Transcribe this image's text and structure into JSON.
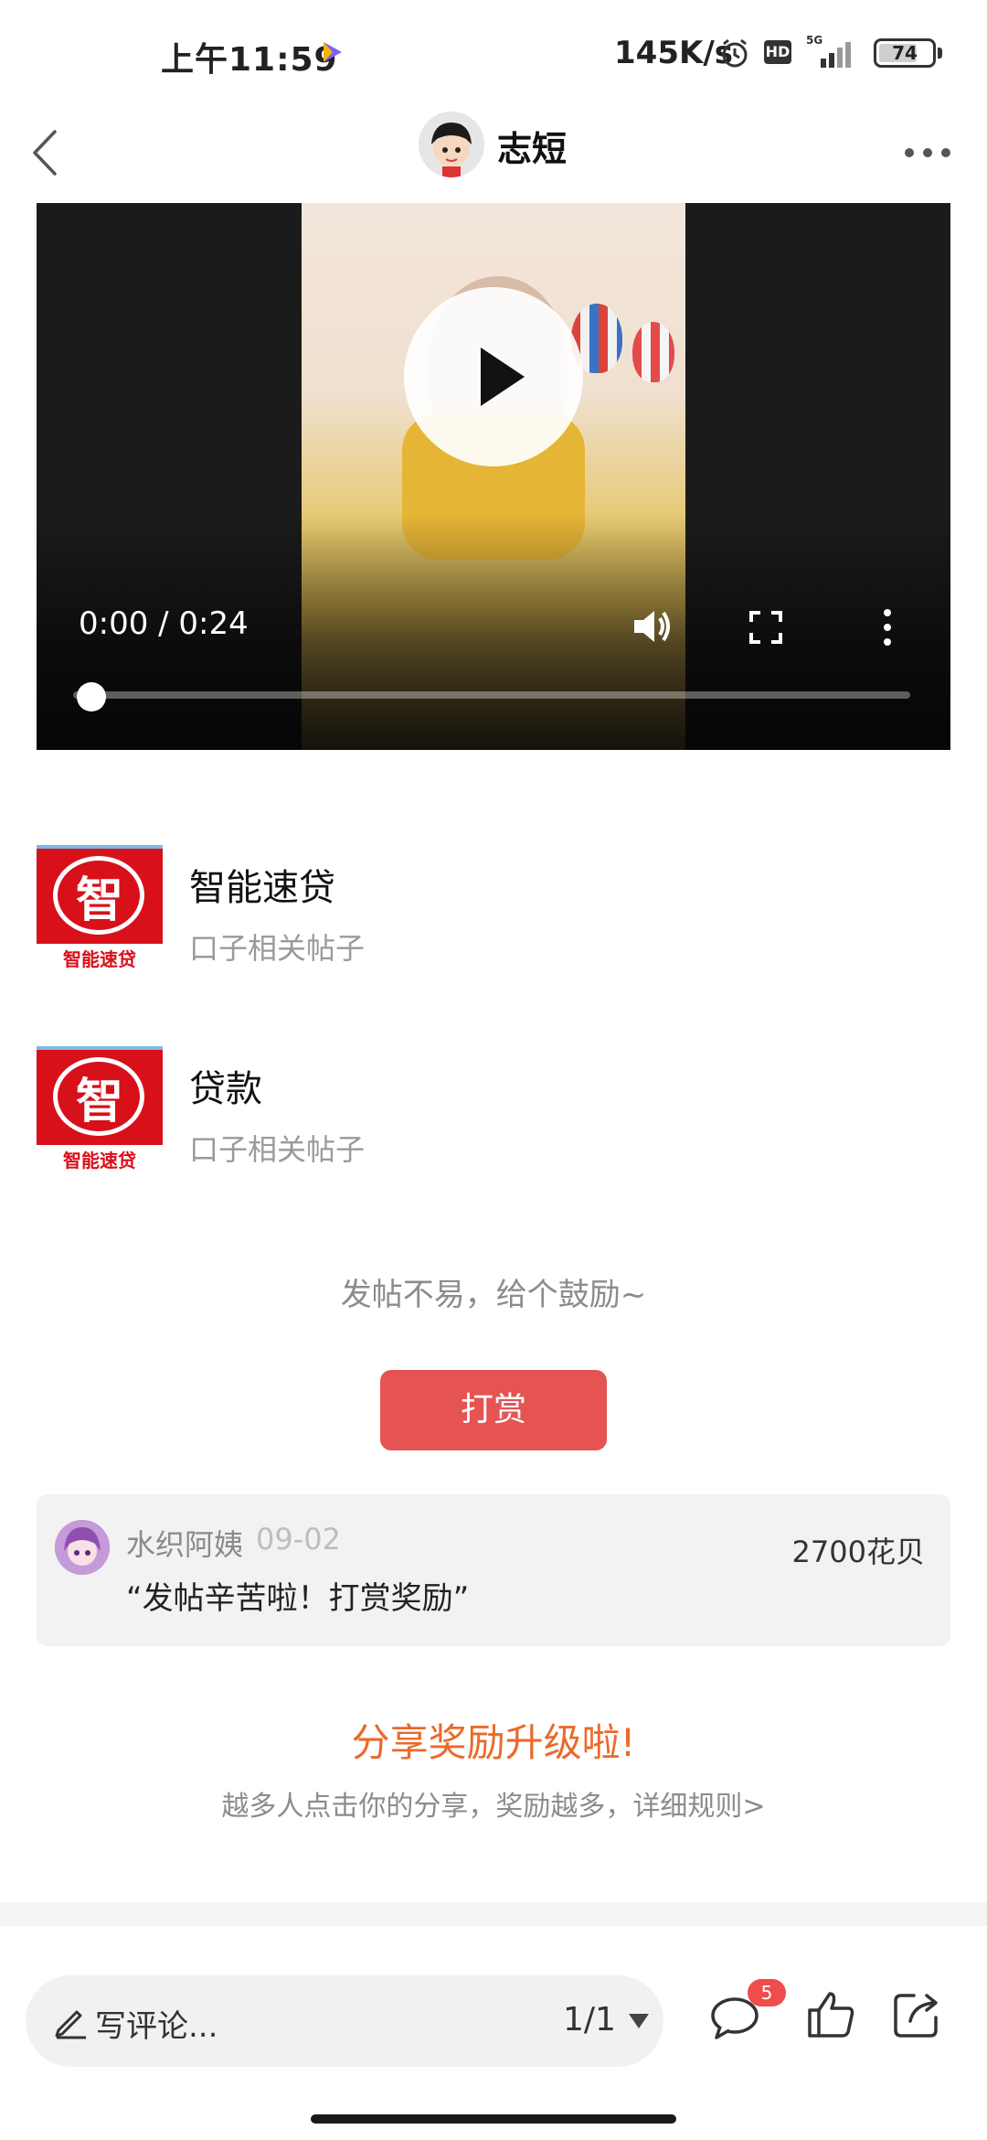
{
  "status_bar": {
    "time": "上午11:59",
    "network_speed": "145K/s",
    "hd_label": "HD",
    "network_type": "5G",
    "battery": "74",
    "battery_level": 0.74
  },
  "header": {
    "title": "志短"
  },
  "video": {
    "current_time": "0:00",
    "duration": "0:24",
    "time_display": "0:00 / 0:24",
    "progress": 0
  },
  "topics": [
    {
      "title": "智能速贷",
      "subtitle": "口子相关帖子",
      "icon_glyph": "智",
      "icon_text": "智能速贷"
    },
    {
      "title": "贷款",
      "subtitle": "口子相关帖子",
      "icon_glyph": "智",
      "icon_text": "智能速贷"
    }
  ],
  "reward": {
    "prompt": "发帖不易，给个鼓励~",
    "button_label": "打赏"
  },
  "reward_record": {
    "user": "水织阿姨",
    "date": "09-02",
    "amount": "2700花贝",
    "message": "“发帖辛苦啦！打赏奖励”"
  },
  "share_promo": {
    "title": "分享奖励升级啦!",
    "subtitle": "越多人点击你的分享，奖励越多，详细规则>"
  },
  "bottom_bar": {
    "comment_placeholder": "写评论...",
    "page_indicator": "1/1",
    "comment_count": "5"
  },
  "colors": {
    "accent_red": "#e55353",
    "promo_orange": "#ea6a2a",
    "badge_red": "#f04c4c"
  },
  "icons": [
    "back-icon",
    "more-icon",
    "play-icon",
    "volume-icon",
    "fullscreen-icon",
    "video-more-icon",
    "pencil-icon",
    "caret-down-icon",
    "comment-icon",
    "like-icon",
    "share-icon",
    "alarm-icon",
    "signal-icon"
  ]
}
